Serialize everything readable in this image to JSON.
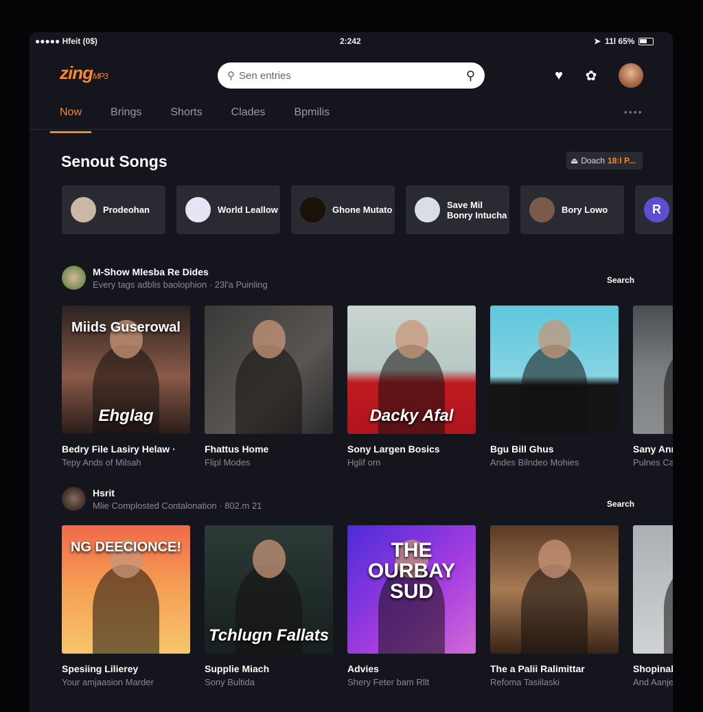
{
  "status_bar": {
    "carrier": "●●●●● Hfeit (0$)",
    "time": "2:242",
    "right": "11l 65%"
  },
  "header": {
    "logo": "zing",
    "logo_suffix": "MP3",
    "search_placeholder": "Sen entries"
  },
  "tabs": [
    {
      "label": "Now",
      "active": true
    },
    {
      "label": "Brings"
    },
    {
      "label": "Shorts"
    },
    {
      "label": "Clades"
    },
    {
      "label": "Bpmilis"
    }
  ],
  "section": {
    "title": "Senout Songs",
    "button_label": "Doach",
    "button_value": "18:l P..."
  },
  "chips": [
    {
      "label": "Prodeohan",
      "color": "#c9b8a5"
    },
    {
      "label": "World Leallow",
      "color": "#e8e4f6"
    },
    {
      "label": "Ghone Mutato",
      "color": "#1a1208"
    },
    {
      "label": "Save Mil Bonry Intucha",
      "color": "#d8dde6"
    },
    {
      "label": "Bory Lowo",
      "color": "#7a5a4a"
    },
    {
      "label": "R",
      "color": "#5b4fd6"
    }
  ],
  "rows": [
    {
      "title": "M-Show Mlesba Re Dides",
      "subtitle": "Every tags adblis baolophion · 23l'a Puinling",
      "action": "Search",
      "cards": [
        {
          "title": "Bedry File Lasiry Helaw ·",
          "subtitle": "Tepy Ands of Milsah",
          "art_text": "Miids Guserowal",
          "art_text2": "Ehglag",
          "bg": "linear-gradient(180deg,#2a2220,#8a5a48 55%,#2a1c1a)"
        },
        {
          "title": "Fhattus Home",
          "subtitle": "Flipl Modes",
          "bg": "linear-gradient(135deg,#3a3a38,#5a5552 60%,#2a2a2c)"
        },
        {
          "title": "Sony Largen Bosics",
          "subtitle": "Hglif orn",
          "art_text2": "Dacky Afal",
          "bg": "linear-gradient(180deg,#c8d4d0 0%,#b8c8c4 50%,#c01a22 60%,#b0141c)"
        },
        {
          "title": "Bgu Bill Ghus",
          "subtitle": "Andes Bilndeo Mohies",
          "bg": "linear-gradient(180deg,#5ec6dc,#86d4e2 55%,#141414 62%)"
        },
        {
          "title": "Sany Ann",
          "subtitle": "Pulnes Ca",
          "bg": "linear-gradient(180deg,#4a4e52,#7a7e80 50%,#8a8e90)"
        }
      ]
    },
    {
      "title": "Hsrit",
      "subtitle": "Mlie Complosted Contalonation · 802.m 21",
      "action": "Search",
      "cards": [
        {
          "title": "Spesiing Lilierey",
          "subtitle": "Your amjaasion Marder",
          "art_text": "NG DEECIONCE!",
          "bg": "linear-gradient(180deg,#f06a4a,#f5a054 50%,#f7c56c)"
        },
        {
          "title": "Supplie Miach",
          "subtitle": "Sony Bultida",
          "art_text2": "Tchlugn Fallats",
          "bg": "linear-gradient(180deg,#2c3a36,#16201e)"
        },
        {
          "title": "Advies",
          "subtitle": "Shery Feter bam Rllt",
          "art_text": "THE OURBAY SUD",
          "bg": "linear-gradient(135deg,#4b2bd8,#a83ee0 60%,#d06ad8)"
        },
        {
          "title": "The a Palii Ralimittar",
          "subtitle": "Refoma Tasiilaski",
          "bg": "linear-gradient(180deg,#5a3a24,#a67a54 50%,#3a2416)"
        },
        {
          "title": "Shopinal",
          "subtitle": "And Aanje",
          "bg": "linear-gradient(180deg,#aab0b4,#cfd3d5)"
        }
      ]
    }
  ],
  "colors": {
    "accent": "#f7872a",
    "background": "#15151d",
    "card": "#2a2a33"
  }
}
